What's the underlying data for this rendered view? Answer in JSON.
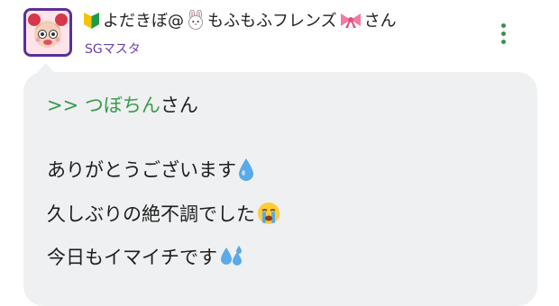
{
  "post": {
    "author": {
      "name_prefix": "よだきぼ@",
      "name_middle": "もふもふフレンズ",
      "name_suffix": "さん",
      "rank": "SGマスタ"
    },
    "reply_to": {
      "link_text": ">> つぼちん",
      "suffix": " さん"
    },
    "lines": [
      "ありがとうございます",
      "久しぶりの絶不調でした",
      "今日もイマイチです"
    ],
    "icons": {
      "badge": "beginner-mark-icon",
      "rabbit": "rabbit-face-icon",
      "ribbon": "ribbon-icon",
      "line1": "droplet-icon",
      "line2": "loudly-crying-face-icon",
      "line3": "sweat-droplets-icon",
      "menu": "more-vertical-icon"
    },
    "colors": {
      "accent_green": "#3a9a4c",
      "rank_purple": "#6d3fb0",
      "bubble_bg": "#eef0f1"
    }
  }
}
